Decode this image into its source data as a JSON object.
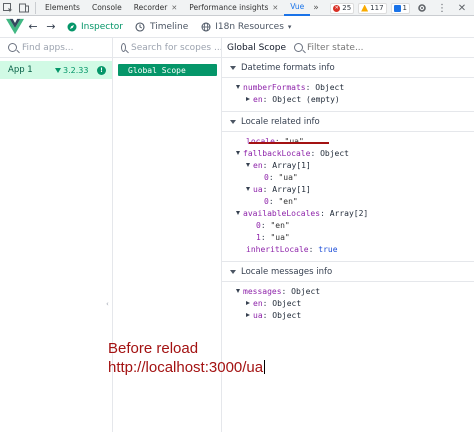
{
  "devtools": {
    "tabs": [
      {
        "label": "Elements"
      },
      {
        "label": "Console"
      },
      {
        "label": "Recorder",
        "closable": true
      },
      {
        "label": "Performance insights",
        "closable": true
      },
      {
        "label": "Vue",
        "active": true
      }
    ],
    "more": "»",
    "errors": "25",
    "warnings": "117",
    "messages": "1"
  },
  "vue_header": {
    "inspector_label": "Inspector",
    "timeline_label": "Timeline",
    "plugin_select": "I18n Resources",
    "back_arrow": "←",
    "forward_arrow": "→",
    "accent_color": "#059669"
  },
  "apps": {
    "search_placeholder": "Find apps...",
    "items": [
      {
        "name": "App 1",
        "version": "3.2.33"
      }
    ]
  },
  "scopes": {
    "search_placeholder": "Search for scopes ...",
    "selected": "Global Scope"
  },
  "state": {
    "title": "Global Scope",
    "filter_placeholder": "Filter state...",
    "sections": {
      "datetime": {
        "title": "Datetime formats info",
        "numberFormats_key": "numberFormats",
        "numberFormats_val": "Object",
        "en_key": "en",
        "en_val": "Object (empty)"
      },
      "locale": {
        "title": "Locale related info",
        "locale_key": "locale",
        "locale_val": "\"ua\"",
        "fallback_key": "fallbackLocale",
        "fallback_val": "Object",
        "en_key": "en",
        "en_val": "Array[1]",
        "en_0_key": "0",
        "en_0_val": "\"ua\"",
        "ua_key": "ua",
        "ua_val": "Array[1]",
        "ua_0_key": "0",
        "ua_0_val": "\"en\"",
        "available_key": "availableLocales",
        "available_val": "Array[2]",
        "avail_0_key": "0",
        "avail_0_val": "\"en\"",
        "avail_1_key": "1",
        "avail_1_val": "\"ua\"",
        "inherit_key": "inheritLocale",
        "inherit_val": "true"
      },
      "messages": {
        "title": "Locale messages info",
        "messages_key": "messages",
        "messages_val": "Object",
        "en_key": "en",
        "en_val": "Object",
        "ua_key": "ua",
        "ua_val": "Object"
      }
    }
  },
  "annotation": {
    "line1": "Before reload",
    "line2": "http://localhost:3000/ua",
    "color": "#a31212"
  }
}
